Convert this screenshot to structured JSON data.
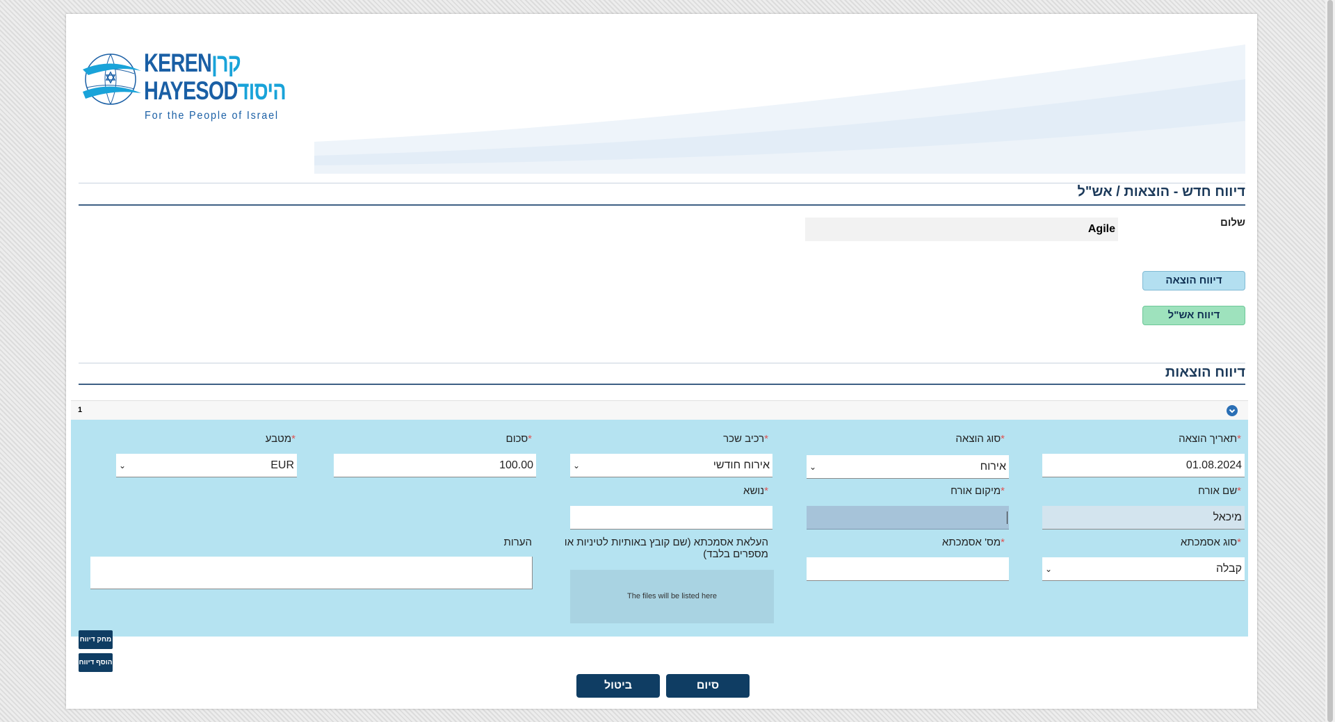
{
  "logo": {
    "hebrew_line1": "קרן",
    "hebrew_line2": "היסוד",
    "latin_line1": "KEREN",
    "latin_line2": "HAYESOD",
    "tagline": "For the People of Israel"
  },
  "page_title": "דיווח חדש - הוצאות / אש\"ל",
  "greeting": {
    "label": "שלום",
    "value": "Agile"
  },
  "side_buttons": {
    "expense_report": "דיווח הוצאה",
    "per_diem_report": "דיווח אש\"ל"
  },
  "expenses_section": {
    "title": "דיווח הוצאות",
    "row_index": "1",
    "fields": {
      "expense_date": {
        "label": "תאריך הוצאה",
        "value": "01.08.2024"
      },
      "expense_type": {
        "label": "סוג הוצאה",
        "value": "אירוח"
      },
      "rental_component": {
        "label": "רכיב שכר",
        "value": "אירוח חודשי"
      },
      "amount": {
        "label": "סכום",
        "value": "100.00"
      },
      "currency": {
        "label": "מטבע",
        "value": "EUR"
      },
      "guest_name": {
        "label": "שם אורח",
        "value": "מיכאל"
      },
      "guest_location": {
        "label": "מיקום אורח",
        "value": ""
      },
      "subject": {
        "label": "נושא",
        "value": ""
      },
      "reference_type": {
        "label": "סוג אסמכתא",
        "value": "קבלה"
      },
      "reference_number": {
        "label": "מס' אסמכתא",
        "value": ""
      },
      "upload": {
        "label": "העלאת אסמכתא (שם קובץ באותיות לטיניות או מספרים בלבד)",
        "placeholder": "The files will be listed here"
      },
      "notes": {
        "label": "הערות",
        "value": ""
      }
    },
    "delete_report": "מחק דיווח",
    "add_report": "הוסף דיווח"
  },
  "footer_buttons": {
    "finish": "סיום",
    "cancel": "ביטול"
  },
  "colors": {
    "panel_blue": "#b5e3f1",
    "navy": "#0f3d63",
    "title_navy": "#1c3a5a",
    "side_btn_blue": "#b3dff0",
    "side_btn_green": "#9ee2bd"
  }
}
